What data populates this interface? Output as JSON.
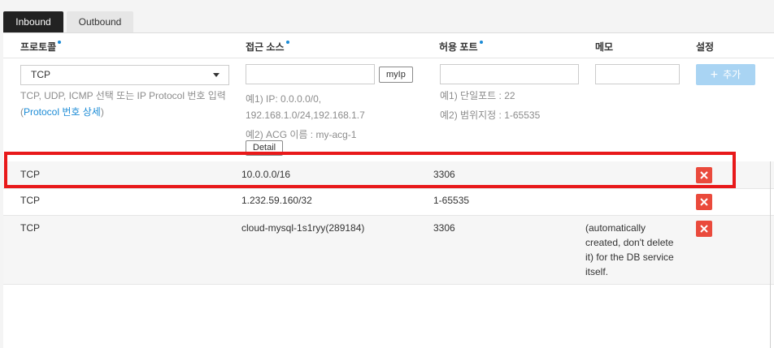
{
  "tabs": [
    {
      "label": "Inbound",
      "active": true
    },
    {
      "label": "Outbound",
      "active": false
    }
  ],
  "columns": {
    "protocol": "프로토콜",
    "source": "접근 소스",
    "port": "허용 포트",
    "memo": "메모",
    "settings": "설정"
  },
  "form": {
    "protocol_selected": "TCP",
    "protocol_help_1": "TCP, UDP, ICMP 선택 또는 IP Protocol 번호 입력",
    "protocol_help_open": "(",
    "protocol_help_link": "Protocol 번호 상세",
    "protocol_help_close": ")",
    "source_value": "",
    "myip_label": "myIp",
    "source_ex1_a": "예1) IP: 0.0.0.0/0,",
    "source_ex1_b": "192.168.1.0/24,192.168.1.7",
    "source_ex2": "예2) ACG 이름 : my-acg-1",
    "detail_label": "Detail",
    "port_value": "",
    "port_ex1": "예1) 단일포트 : 22",
    "port_ex2": "예2) 범위지정 : 1-65535",
    "memo_value": "",
    "add_label": "추가",
    "add_icon": "plus-icon"
  },
  "rules": [
    {
      "protocol": "TCP",
      "source": "10.0.0.0/16",
      "port": "3306",
      "memo": ""
    },
    {
      "protocol": "TCP",
      "source": "1.232.59.160/32",
      "port": "1-65535",
      "memo": ""
    },
    {
      "protocol": "TCP",
      "source": "cloud-mysql-1s1ryy(289184)",
      "port": "3306",
      "memo_lines": [
        "(automatically",
        "created, don't delete",
        "it) for the DB service",
        "itself."
      ]
    }
  ],
  "colors": {
    "accent": "#1b8bd6",
    "delete": "#ea4a3c",
    "highlight": "#e8191a",
    "add_button": "#a9d4f3"
  }
}
